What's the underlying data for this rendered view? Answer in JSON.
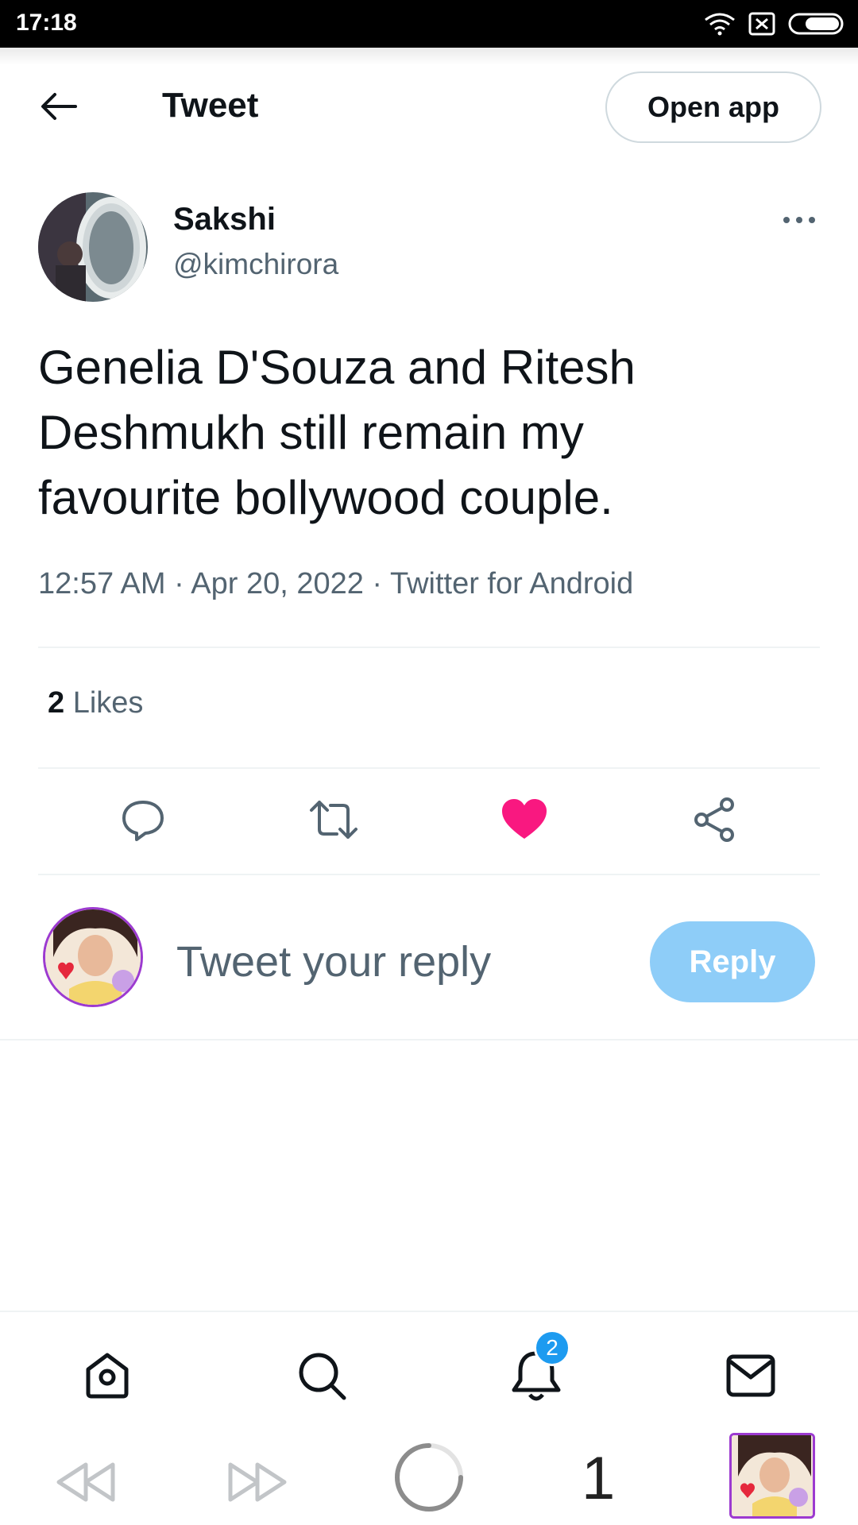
{
  "status_bar": {
    "time": "17:18",
    "icons": [
      "wifi-icon",
      "sim-icon",
      "battery-icon"
    ]
  },
  "header": {
    "title": "Tweet",
    "open_app_label": "Open app",
    "back_icon": "back-arrow-icon"
  },
  "author": {
    "name": "Sakshi",
    "handle": "@kimchirora"
  },
  "tweet": {
    "lines": [
      "Genelia D'Souza and Ritesh",
      "Deshmukh still remain my",
      "favourite bollywood couple."
    ],
    "time": "12:57 AM",
    "date": "Apr 20, 2022",
    "source": "Twitter for Android",
    "separator": " · "
  },
  "stats": {
    "likes_count": "2",
    "likes_label": "Likes"
  },
  "actions": [
    "reply-icon",
    "retweet-icon",
    "like-icon",
    "share-icon"
  ],
  "colors": {
    "like": "#f91880",
    "reply_button": "#8ecdf8",
    "badge": "#1d9bf0",
    "avatar_border": "#9c3ad0"
  },
  "composer": {
    "placeholder": "Tweet your reply",
    "reply_label": "Reply"
  },
  "bottom_nav": {
    "items": [
      "home-icon",
      "search-icon",
      "notifications-icon",
      "messages-icon"
    ],
    "notification_badge": "2"
  },
  "media_bar": {
    "page_number": "1",
    "items": [
      "rewind-icon",
      "fast-forward-icon",
      "loading-spinner-icon",
      "thumbnail"
    ]
  }
}
